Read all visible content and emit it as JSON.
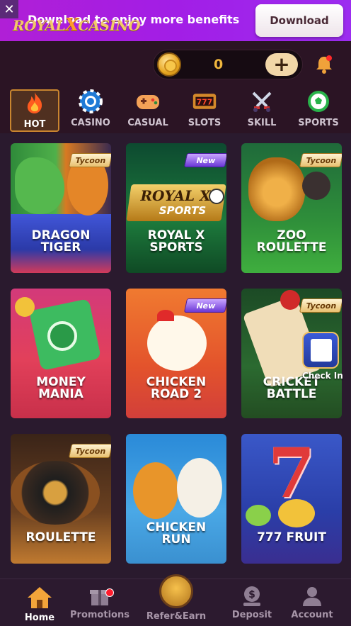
{
  "banner": {
    "message": "Download to enjoy more benefits",
    "download_label": "Download"
  },
  "header": {
    "logo_royal": "ROYAL",
    "logo_x": "X",
    "logo_casino": "CASINO",
    "balance": "0"
  },
  "categories": [
    {
      "label": "HOT",
      "icon": "flame-icon"
    },
    {
      "label": "CASINO",
      "icon": "chip-icon"
    },
    {
      "label": "CASUAL",
      "icon": "gamepad-icon"
    },
    {
      "label": "SLOTS",
      "icon": "slot-machine-icon"
    },
    {
      "label": "SKILL",
      "icon": "swords-icon"
    },
    {
      "label": "SPORTS",
      "icon": "soccer-ball-icon"
    }
  ],
  "games": [
    {
      "title1": "DRAGON",
      "title2": "TIGER",
      "tag": "Tycoon"
    },
    {
      "title1": "ROYAL X",
      "title2": "SPORTS",
      "tag": "New",
      "art_line1": "ROYAL X",
      "art_line2": "SPORTS"
    },
    {
      "title1": "ZOO",
      "title2": "ROULETTE",
      "tag": "Tycoon"
    },
    {
      "title1": "MONEY",
      "title2": "MANIA"
    },
    {
      "title1": "CHICKEN",
      "title2": "ROAD 2",
      "tag": "New"
    },
    {
      "title1": "CRICKET",
      "title2": "BATTLE",
      "tag": "Tycoon",
      "overlay": "Check In"
    },
    {
      "title1": "ROULETTE",
      "title2": "",
      "tag": "Tycoon"
    },
    {
      "title1": "CHICKEN",
      "title2": "RUN"
    },
    {
      "title1": "777 FRUIT",
      "title2": ""
    }
  ],
  "nav": [
    {
      "label": "Home",
      "icon": "home-icon"
    },
    {
      "label": "Promotions",
      "icon": "gift-icon"
    },
    {
      "label": "Refer&Earn",
      "icon": "refer-icon"
    },
    {
      "label": "Deposit",
      "icon": "deposit-icon"
    },
    {
      "label": "Account",
      "icon": "user-icon"
    }
  ],
  "colors": {
    "accent": "#f0b73e",
    "banner": "#a21ee6",
    "background": "#2a1a2e"
  }
}
